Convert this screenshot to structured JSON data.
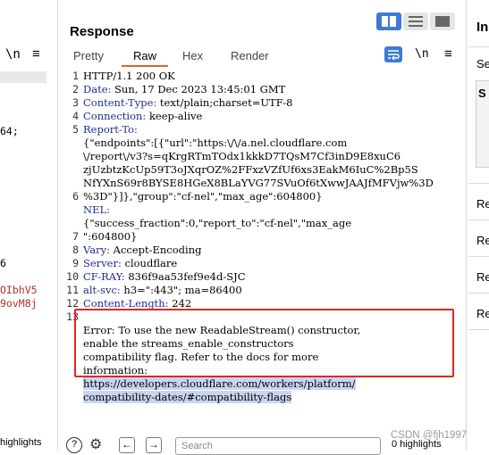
{
  "left_pane": {
    "toolbar": {
      "newline_label": "\\n",
      "menu_icon": "≡"
    },
    "lines": [
      {
        "text": "",
        "red": false
      },
      {
        "text": "",
        "red": false
      },
      {
        "text": "",
        "red": false
      },
      {
        "text": "",
        "red": false
      },
      {
        "text": "64;",
        "red": false
      },
      {
        "text": "",
        "red": false
      },
      {
        "text": "",
        "red": false
      },
      {
        "text": "",
        "red": false
      },
      {
        "text": "",
        "red": false
      },
      {
        "text": "",
        "red": false
      },
      {
        "text": "",
        "red": false
      },
      {
        "text": "",
        "red": false
      },
      {
        "text": "",
        "red": false
      },
      {
        "text": "",
        "red": false
      },
      {
        "text": "6",
        "red": false
      },
      {
        "text": "",
        "red": false
      },
      {
        "text": "OIbhV5",
        "red": true
      },
      {
        "text": "9ovM8j",
        "red": true
      }
    ],
    "bottom_text": "highlights"
  },
  "response": {
    "title": "Response",
    "tabs": [
      "Pretty",
      "Raw",
      "Hex",
      "Render"
    ],
    "active_tab": "Raw",
    "newline_label": "\\n",
    "line_numbers": [
      "1",
      "2",
      "3",
      "4",
      "5",
      "",
      "",
      "",
      "",
      "6",
      "",
      "",
      "7",
      "8",
      "9",
      "10",
      "11",
      "12",
      "13",
      "",
      "",
      "",
      "",
      "",
      ""
    ],
    "rows": [
      {
        "key": "",
        "val": "HTTP/1.1 200 OK",
        "sel": false
      },
      {
        "key": "Date:",
        "val": " Sun, 17 Dec 2023 13:45:01 GMT",
        "sel": false
      },
      {
        "key": "Content-Type:",
        "val": " text/plain;charset=UTF-8",
        "sel": false
      },
      {
        "key": "Connection:",
        "val": " keep-alive",
        "sel": false
      },
      {
        "key": "Report-To:",
        "val": "",
        "sel": false
      },
      {
        "key": "",
        "val": "{\"endpoints\":[{\"url\":\"https:\\/\\/a.nel.cloudflare.com",
        "sel": false
      },
      {
        "key": "",
        "val": "\\/report\\/v3?s=qKrgRTmTOdx1kkkD7TQsM7Cf3inD9E8xuC6",
        "sel": false
      },
      {
        "key": "",
        "val": "zjUzbtzKcUp59T3oJXqrOZ%2FFxzVZfUf6xs3EakM6IuC%2Bp5S",
        "sel": false
      },
      {
        "key": "",
        "val": "NfYXnS69r8BYSE8HGeX8BLaYVG77SVuOf6tXwwJAAJfMFVjw%3D",
        "sel": false
      },
      {
        "key": "",
        "val": "%3D\"}]},\"group\":\"cf-nel\",\"max_age\":604800}",
        "sel": false
      },
      {
        "key": "NEL:",
        "val": "",
        "sel": false
      },
      {
        "key": "",
        "val": "{\"success_fraction\":0,\"report_to\":\"cf-nel\",\"max_age",
        "sel": false
      },
      {
        "key": "",
        "val": "\":604800}",
        "sel": false
      },
      {
        "key": "Vary:",
        "val": " Accept-Encoding",
        "sel": false
      },
      {
        "key": "Server:",
        "val": " cloudflare",
        "sel": false
      },
      {
        "key": "CF-RAY:",
        "val": " 836f9aa53fef9e4d-SJC",
        "sel": false
      },
      {
        "key": "alt-svc:",
        "val": " h3=\":443\"; ma=86400",
        "sel": false
      },
      {
        "key": "Content-Length:",
        "val": " 242",
        "sel": false
      },
      {
        "key": "",
        "val": "",
        "sel": false
      },
      {
        "key": "",
        "val": "Error: To use the new ReadableStream() constructor,",
        "sel": false
      },
      {
        "key": "",
        "val": " enable the streams_enable_constructors",
        "sel": false
      },
      {
        "key": "",
        "val": "compatibility flag. Refer to the docs for more",
        "sel": false
      },
      {
        "key": "",
        "val": "information:",
        "sel": false
      },
      {
        "key": "",
        "val": "https://developers.cloudflare.com/workers/platform/",
        "sel": true
      },
      {
        "key": "",
        "val": "compatibility-dates/#compatibility-flags",
        "sel": true
      }
    ],
    "search_placeholder": "Search",
    "highlights_label": "0 highlights"
  },
  "inspector": {
    "title": "Inspector",
    "rows": [
      "Se",
      "S",
      "Re",
      "Re",
      "Re",
      "Re"
    ]
  },
  "watermark": "CSDN @fjh1997",
  "colors": {
    "accent": "#3d7ad6",
    "tab_underline": "#e0612b",
    "error_box": "#e0281e",
    "header_key": "#1f2f8f"
  }
}
